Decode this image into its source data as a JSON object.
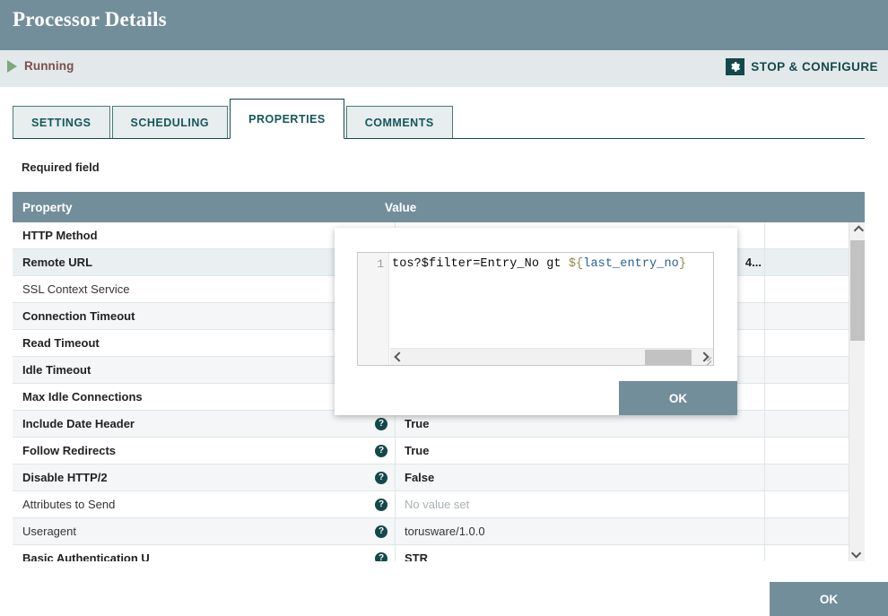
{
  "window": {
    "title": "Processor Details"
  },
  "status": {
    "state_label": "Running",
    "play_icon": "play-icon",
    "stop_configure_label": "STOP & CONFIGURE",
    "gear_icon": "gear-icon"
  },
  "tabs": [
    {
      "label": "SETTINGS",
      "active": false
    },
    {
      "label": "SCHEDULING",
      "active": false
    },
    {
      "label": "PROPERTIES",
      "active": true
    },
    {
      "label": "COMMENTS",
      "active": false
    }
  ],
  "required_note": "Required field",
  "table": {
    "columns": [
      "Property",
      "Value"
    ],
    "rows": [
      {
        "name": "HTTP Method",
        "required": true,
        "value": "",
        "help": false,
        "empty": false,
        "selected": false
      },
      {
        "name": "Remote URL",
        "required": true,
        "value": "4...",
        "help": false,
        "empty": false,
        "selected": true
      },
      {
        "name": "SSL Context Service",
        "required": false,
        "value": "",
        "help": false,
        "empty": false,
        "selected": false
      },
      {
        "name": "Connection Timeout",
        "required": true,
        "value": "",
        "help": false,
        "empty": false,
        "selected": false
      },
      {
        "name": "Read Timeout",
        "required": true,
        "value": "",
        "help": false,
        "empty": false,
        "selected": false
      },
      {
        "name": "Idle Timeout",
        "required": true,
        "value": "",
        "help": false,
        "empty": false,
        "selected": false
      },
      {
        "name": "Max Idle Connections",
        "required": true,
        "value": "",
        "help": false,
        "empty": false,
        "selected": false
      },
      {
        "name": "Include Date Header",
        "required": true,
        "value": "True",
        "help": true,
        "empty": false,
        "selected": false
      },
      {
        "name": "Follow Redirects",
        "required": true,
        "value": "True",
        "help": true,
        "empty": false,
        "selected": false
      },
      {
        "name": "Disable HTTP/2",
        "required": true,
        "value": "False",
        "help": true,
        "empty": false,
        "selected": false
      },
      {
        "name": "Attributes to Send",
        "required": false,
        "value": "No value set",
        "help": true,
        "empty": true,
        "selected": false
      },
      {
        "name": "Useragent",
        "required": false,
        "value": "torusware/1.0.0",
        "help": true,
        "empty": false,
        "selected": false
      },
      {
        "name": "Basic Authentication U",
        "required": true,
        "value": "STR",
        "help": true,
        "empty": false,
        "selected": false
      }
    ]
  },
  "scrollbars": {
    "vertical_up_icon": "chevron-up-icon",
    "vertical_down_icon": "chevron-down-icon",
    "horizontal_left_icon": "chevron-left-icon",
    "horizontal_right_icon": "chevron-right-icon",
    "resize_icon": "resize-grip-icon"
  },
  "modal": {
    "line_number": "1",
    "code": {
      "prefix": "tos?$filter=Entry_No gt ",
      "open_brace": "${",
      "variable": "last_entry_no",
      "close_brace": "}"
    },
    "ok_label": "OK"
  },
  "footer": {
    "ok_label": "OK"
  },
  "colors": {
    "header_bar": "#728e9b",
    "status_strip": "#e3e8ea",
    "accent_dark": "#14494a",
    "running_text": "#7a4f4f",
    "play_green": "#7da87b",
    "button": "#728e9b",
    "code_variable": "#2b5f9b",
    "code_brace": "#8f8a4e"
  }
}
